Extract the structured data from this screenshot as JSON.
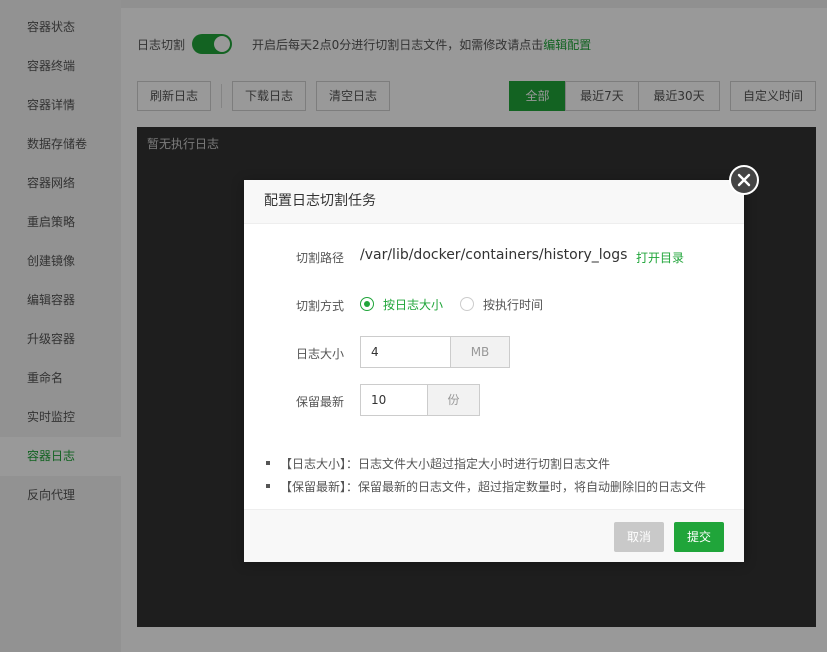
{
  "sidebar": {
    "items": [
      {
        "label": "容器状态"
      },
      {
        "label": "容器终端"
      },
      {
        "label": "容器详情"
      },
      {
        "label": "数据存储卷"
      },
      {
        "label": "容器网络"
      },
      {
        "label": "重启策略"
      },
      {
        "label": "创建镜像"
      },
      {
        "label": "编辑容器"
      },
      {
        "label": "升级容器"
      },
      {
        "label": "重命名"
      },
      {
        "label": "实时监控"
      },
      {
        "label": "容器日志"
      },
      {
        "label": "反向代理"
      }
    ],
    "active_index": 11
  },
  "header": {
    "toggle_label": "日志切割",
    "toggle_on": true,
    "note_text": "开启后每天2点0分进行切割日志文件，如需修改请点击",
    "note_link": "编辑配置"
  },
  "toolbar": {
    "refresh": "刷新日志",
    "download": "下载日志",
    "clear": "清空日志",
    "ranges": [
      "全部",
      "最近7天",
      "最近30天"
    ],
    "active_range": 0,
    "custom": "自定义时间"
  },
  "console": {
    "empty_text": "暂无执行日志"
  },
  "modal": {
    "title": "配置日志切割任务",
    "path_label": "切割路径",
    "path_value": "/var/lib/docker/containers/history_logs",
    "open_dir": "打开目录",
    "mode_label": "切割方式",
    "mode_options": [
      "按日志大小",
      "按执行时间"
    ],
    "mode_selected": 0,
    "size_label": "日志大小",
    "size_value": "4",
    "size_unit": "MB",
    "keep_label": "保留最新",
    "keep_value": "10",
    "keep_unit": "份",
    "tips": [
      "【日志大小】：日志文件大小超过指定大小时进行切割日志文件",
      "【保留最新】：保留最新的日志文件，超过指定数量时，将自动删除旧的日志文件"
    ],
    "cancel": "取消",
    "submit": "提交"
  },
  "colors": {
    "accent": "#20a53a",
    "console_bg": "#333333",
    "cancel_bg": "#c9c9c9"
  }
}
